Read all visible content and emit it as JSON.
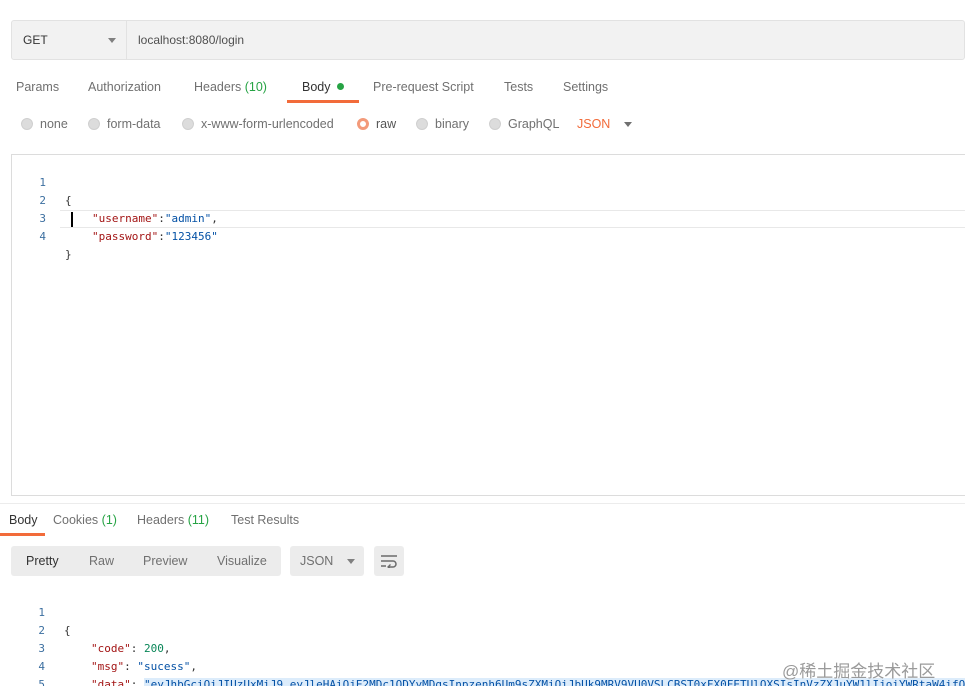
{
  "request": {
    "method": "GET",
    "url": "localhost:8080/login"
  },
  "request_tabs": [
    {
      "label": "Params"
    },
    {
      "label": "Authorization"
    },
    {
      "label": "Headers",
      "count": "(10)"
    },
    {
      "label": "Body"
    },
    {
      "label": "Pre-request Script"
    },
    {
      "label": "Tests"
    },
    {
      "label": "Settings"
    }
  ],
  "body_types": [
    "none",
    "form-data",
    "x-www-form-urlencoded",
    "raw",
    "binary",
    "GraphQL"
  ],
  "body_type_selected": "raw",
  "body_language": "JSON",
  "request_body": {
    "line_numbers": [
      "1",
      "2",
      "3",
      "4"
    ],
    "open": "{",
    "username_key": "\"username\"",
    "username_val": "\"admin\"",
    "password_key": "\"password\"",
    "password_val": "\"123456\"",
    "close": "}"
  },
  "response_tabs": [
    {
      "label": "Body"
    },
    {
      "label": "Cookies",
      "count": "(1)"
    },
    {
      "label": "Headers",
      "count": "(11)"
    },
    {
      "label": "Test Results"
    }
  ],
  "view_modes": [
    "Pretty",
    "Raw",
    "Preview",
    "Visualize"
  ],
  "response_format": "JSON",
  "response_body": {
    "line_numbers": [
      "1",
      "2",
      "3",
      "4",
      "5"
    ],
    "open": "{",
    "code_key": "\"code\"",
    "code_val": "200",
    "msg_key": "\"msg\"",
    "msg_val": "\"sucess\"",
    "data_key": "\"data\"",
    "data_val": "\"eyJhbGciOiJIUzUxMiJ9.eyJleHAiOjE2MDc1ODYyMDgsInpzenh6Um9sZXMiOiJbUk9MRV9VU0VSLCBST0xFX0FETUlOXSIsInVzZXJuYW1lIjoiYWRtaW4ifQ.",
    "close": "}"
  },
  "watermark": "@稀土掘金技术社区",
  "colors": {
    "accent": "#f26b3a",
    "count_green": "#26a344"
  }
}
